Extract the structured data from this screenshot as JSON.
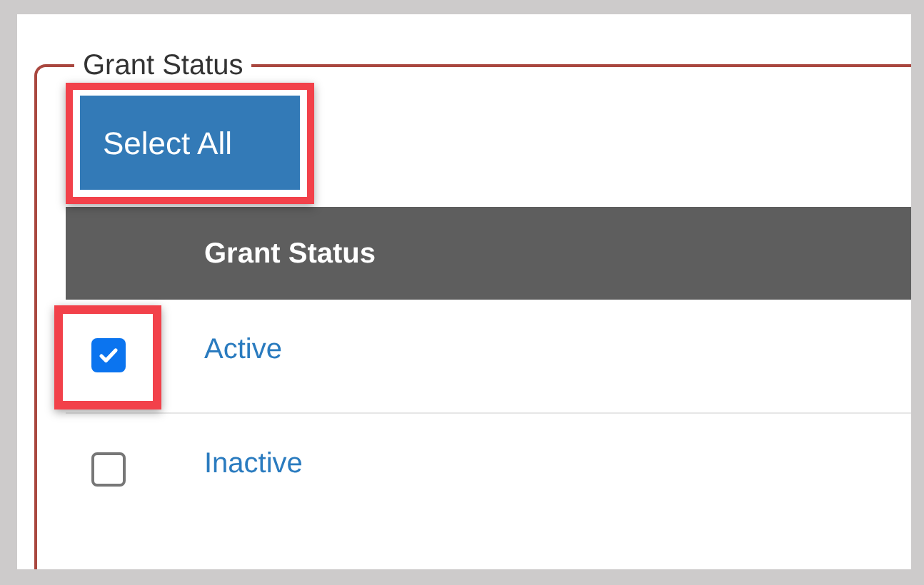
{
  "fieldset": {
    "legend": "Grant Status"
  },
  "select_all_button": {
    "label": "Select All",
    "highlighted": true
  },
  "table": {
    "columns": [
      "Grant Status"
    ],
    "rows": [
      {
        "label": "Active",
        "checked": true,
        "highlighted": true
      },
      {
        "label": "Inactive",
        "checked": false,
        "highlighted": false
      }
    ]
  }
}
